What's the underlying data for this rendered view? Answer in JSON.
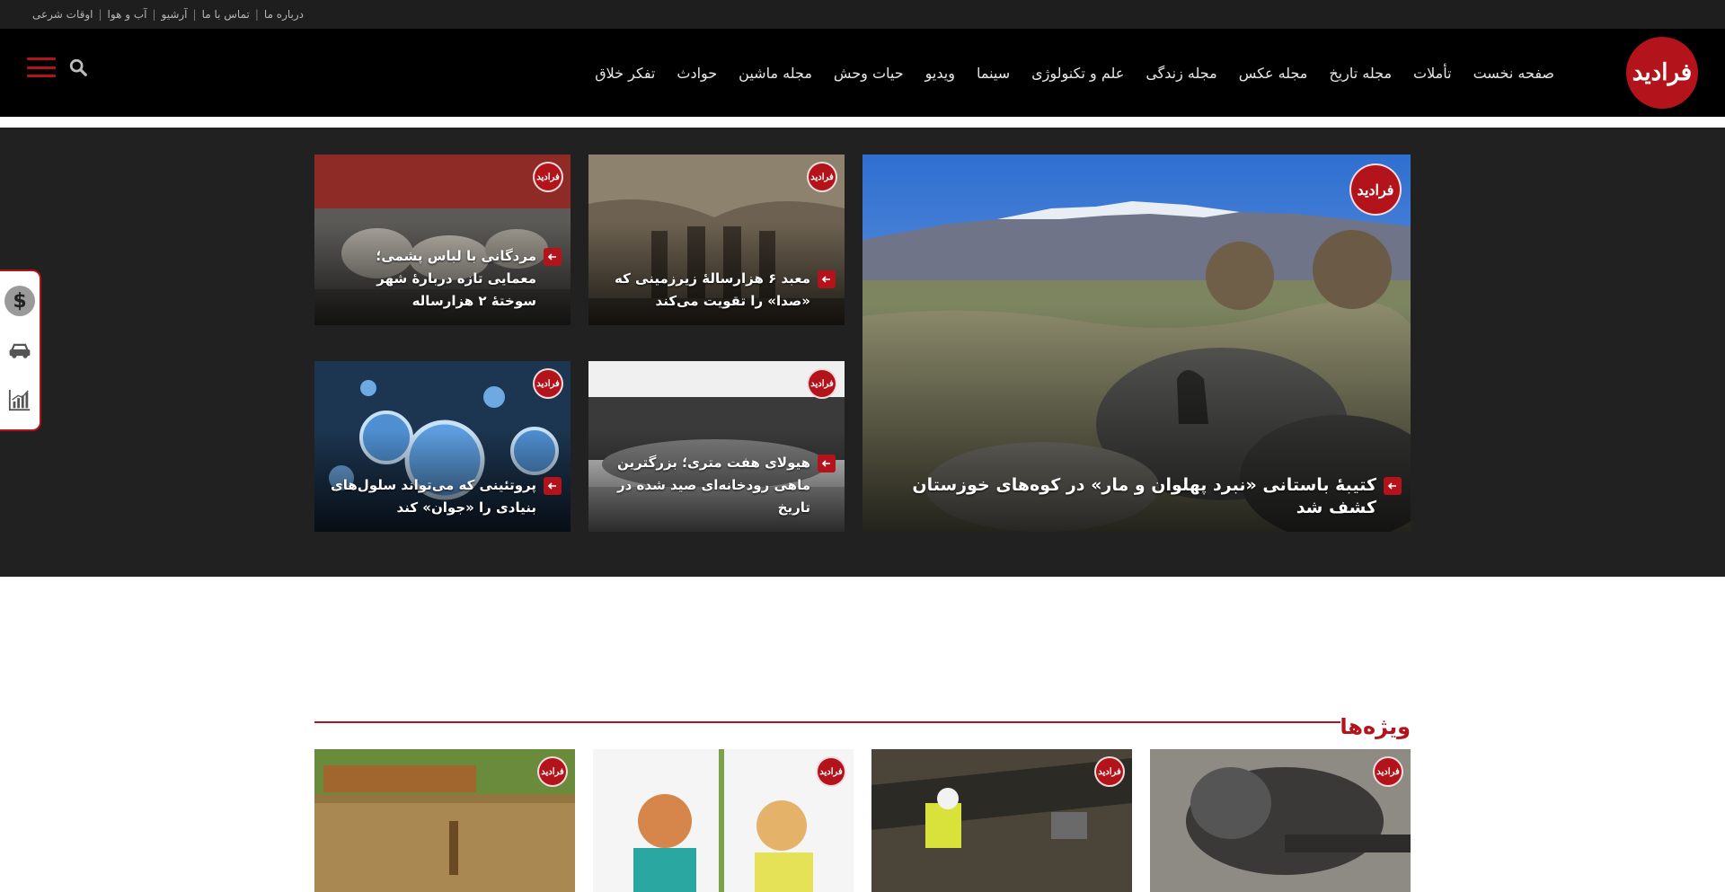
{
  "topbar": {
    "links": [
      "درباره ما",
      "تماس با ما",
      "آرشیو",
      "آب و هوا",
      "اوقات شرعی"
    ],
    "separator": "|"
  },
  "header": {
    "logo_text": "فرادید",
    "nav": [
      "صفحه نخست",
      "تأملات",
      "مجله تاریخ",
      "مجله عکس",
      "مجله زندگی",
      "علم و تکنولوژی",
      "سینما",
      "ویدیو",
      "حیات وحش",
      "مجله ماشین",
      "حوادث",
      "تفکر خلاق"
    ]
  },
  "hero": {
    "main": {
      "title": "کتیبهٔ باستانی «نبرد پهلوان و مار» در کوه‌های خوزستان کشف شد"
    },
    "cards": [
      {
        "title": "معبد ۶ هزارسالهٔ زیرزمینی که «صدا» را تقویت می‌کند"
      },
      {
        "title": "مردگانی با لباس پشمی؛ معمایی تازه دربارهٔ شهر سوختهٔ ۲ هزارساله"
      },
      {
        "title": "هیولای هفت متری؛ بزرگترین ماهی رودخانه‌ای صید شده در تاریخ"
      },
      {
        "title": "پروتئینی که می‌تواند سلول‌های بنیادی را «جوان» کند"
      }
    ]
  },
  "featured": {
    "title": "ویژه‌ها"
  },
  "colors": {
    "brand": "#b3141b",
    "header_bg": "#000000",
    "hero_bg": "#212121"
  },
  "icons": [
    "search-icon",
    "menu-icon",
    "dollar-icon",
    "car-icon",
    "chart-icon",
    "arrow-left-icon"
  ]
}
